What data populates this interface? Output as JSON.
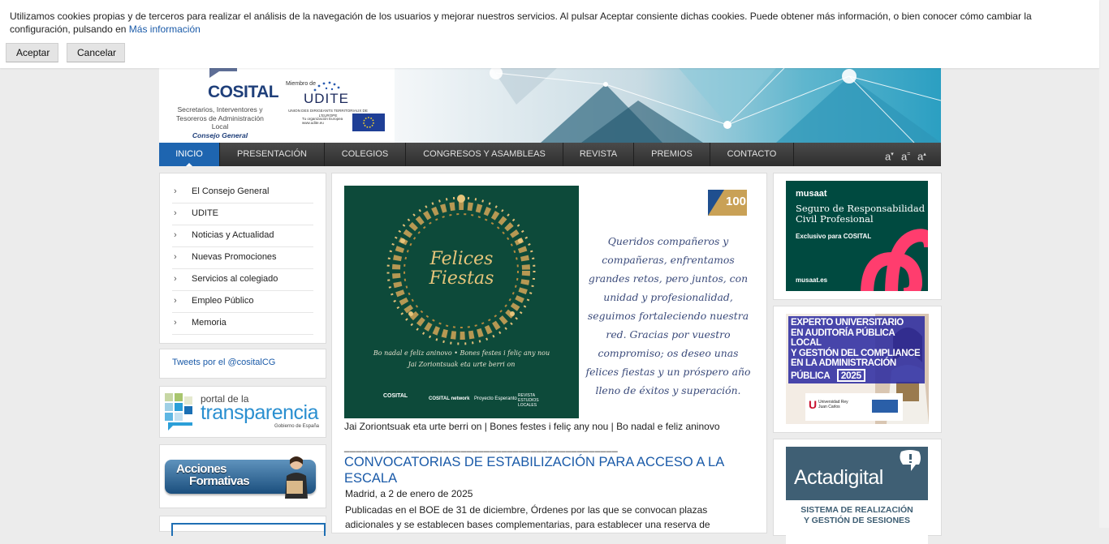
{
  "cookie": {
    "text": "Utilizamos cookies propias y de terceros para realizar el análisis de la navegación de los usuarios y mejorar nuestros servicios. Al pulsar Aceptar consiente dichas cookies. Puede obtener más información, o bien conocer cómo cambiar la configuración, pulsando en",
    "link": "Más información",
    "accept": "Aceptar",
    "cancel": "Cancelar"
  },
  "header": {
    "cosital": "COSITAL",
    "cosital_sub1": "Secretarios, Interventores y",
    "cosital_sub2": "Tesoreros de Administración Local",
    "cosital_sub3": "Consejo General",
    "udite_miembro": "Miembro de",
    "udite": "UDITE",
    "udite_sub": "UNION DES DIRIGEANTS TERRITORIAUX DE L'EUROPE",
    "udite_sub2": "Tu organización Europea",
    "udite_url": "www.udite.eu"
  },
  "nav": {
    "items": [
      "INICIO",
      "PRESENTACIÓN",
      "COLEGIOS",
      "CONGRESOS Y ASAMBLEAS",
      "REVISTA",
      "PREMIOS",
      "CONTACTO"
    ],
    "font_smaller": "a",
    "font_reset": "a",
    "font_larger": "a"
  },
  "sidebar": {
    "items": [
      "El Consejo General",
      "UDITE",
      "Noticias y Actualidad",
      "Nuevas Promociones",
      "Servicios al colegiado",
      "Empleo Público",
      "Memoria"
    ],
    "tweets": "Tweets por el @cositalCG",
    "transparencia_top": "portal de la",
    "transparencia_main": "transparencia",
    "transparencia_sub": "Gobierno de España",
    "acciones_1": "Acciones",
    "acciones_2": "Formativas"
  },
  "main": {
    "wreath_title_1": "Felices",
    "wreath_title_2": "Fiestas",
    "wreath_lower_1": "Bo nadal e feliz aninovo • Bones festes i feliç any nou",
    "wreath_lower_2": "Jai Zoriontsuak eta urte berri on",
    "logo_cosital": "COSITAL",
    "logo_network": "COSITAL network",
    "logo_esperanto": "Proyecto Esperanto",
    "logo_revista": "REVISTA ESTUDIOS LOCALES",
    "badge": "100",
    "letter": "Queridos compañeros y compañeras, enfrentamos grandes retos, pero juntos, con unidad y profesionalidad, seguimos fortaleciendo nuestra red. Gracias por vuestro compromiso; os deseo unas felices fiestas y un próspero año lleno de éxitos y superación.",
    "caption": "Jai Zoriontsuak eta urte berri on | Bones festes i feliç any nou | Bo nadal e feliz aninovo",
    "separator": "_______________________________________________",
    "news_title": "CONVOCATORIAS DE ESTABILIZACIÓN PARA ACCESO A LA ESCALA",
    "news_date": "Madrid, a 2 de enero de 2025",
    "news_body": "Publicadas en el BOE de 31 de diciembre, Órdenes por las que se convocan plazas adicionales y se establecen bases complementarias, para establecer una reserva de"
  },
  "ads": {
    "musaat_brand": "musaat",
    "musaat_title": "Seguro de Responsabilidad Civil Profesional",
    "musaat_sub": "Exclusivo para COSITAL",
    "musaat_url": "musaat.es",
    "experto_1": "EXPERTO UNIVERSITARIO",
    "experto_2": "EN AUDITORÍA PÚBLICA LOCAL",
    "experto_3": "Y GESTIÓN DEL COMPLIANCE",
    "experto_4": "EN LA ADMINISTRACIÓN",
    "experto_5": "PÚBLICA",
    "experto_year": "2025",
    "experto_univ": "Universidad Rey Juan Carlos",
    "acta_brand": "Actadigital",
    "acta_sub1": "SISTEMA DE REALIZACIÓN",
    "acta_sub2": "Y GESTIÓN DE SESIONES"
  }
}
